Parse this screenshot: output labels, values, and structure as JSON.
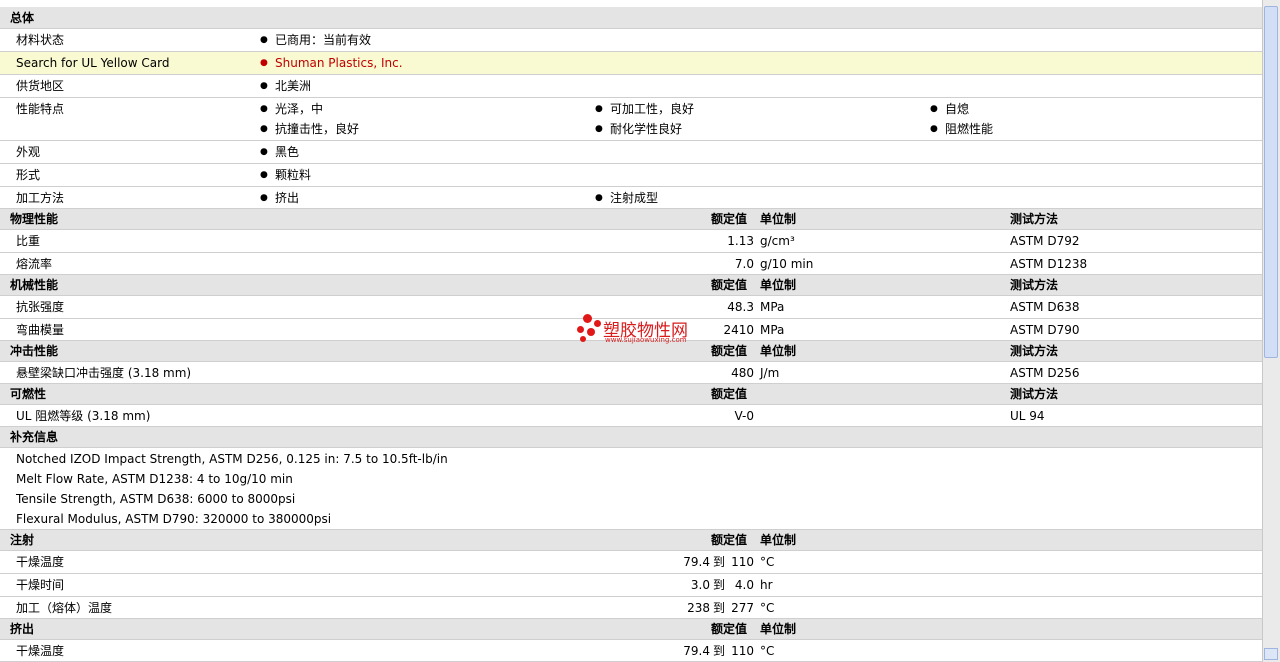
{
  "overall": {
    "title": "总体",
    "rows": [
      {
        "label": "材料状态",
        "items": [
          "已商用：当前有效"
        ]
      },
      {
        "label": "Search for UL Yellow Card",
        "items": [
          "Shuman Plastics, Inc."
        ]
      },
      {
        "label": "供货地区",
        "items": [
          "北美洲"
        ]
      },
      {
        "label": "性能特点",
        "items": [
          "光泽，中",
          "抗撞击性，良好",
          "可加工性，良好",
          "耐化学性良好",
          "自熄",
          "阻燃性能"
        ]
      },
      {
        "label": "外观",
        "items": [
          "黑色"
        ]
      },
      {
        "label": "形式",
        "items": [
          "颗粒料"
        ]
      },
      {
        "label": "加工方法",
        "items": [
          "挤出",
          "注射成型"
        ]
      }
    ]
  },
  "col_headers": {
    "nominal": "额定值",
    "unit": "单位制",
    "method": "测试方法"
  },
  "physical": {
    "title": "物理性能",
    "rows": [
      {
        "label": "比重",
        "value": "1.13",
        "unit": "g/cm³",
        "method": "ASTM D792"
      },
      {
        "label": "熔流率",
        "value": "7.0",
        "unit": "g/10 min",
        "method": "ASTM D1238"
      }
    ]
  },
  "mechanical": {
    "title": "机械性能",
    "rows": [
      {
        "label": "抗张强度",
        "value": "48.3",
        "unit": "MPa",
        "method": "ASTM D638"
      },
      {
        "label": "弯曲模量",
        "value": "2410",
        "unit": "MPa",
        "method": "ASTM D790"
      }
    ]
  },
  "impact": {
    "title": "冲击性能",
    "rows": [
      {
        "label": "悬壁梁缺口冲击强度  (3.18 mm)",
        "value": "480",
        "unit": "J/m",
        "method": "ASTM D256"
      }
    ]
  },
  "flammability": {
    "title": "可燃性",
    "rows": [
      {
        "label": "UL 阻燃等级  (3.18 mm)",
        "value": "V-0",
        "method": "UL 94"
      }
    ]
  },
  "supplemental": {
    "title": "补充信息",
    "lines": [
      "Notched IZOD Impact Strength, ASTM D256, 0.125 in: 7.5 to 10.5ft-lb/in",
      "Melt Flow Rate, ASTM D1238: 4 to 10g/10 min",
      "Tensile Strength, ASTM D638: 6000 to 8000psi",
      "Flexural Modulus, ASTM D790: 320000 to 380000psi"
    ]
  },
  "range_word": "到",
  "injection": {
    "title": "注射",
    "rows": [
      {
        "label": "干燥温度",
        "low": "79.4",
        "high": "110",
        "unit": "°C"
      },
      {
        "label": "干燥时间",
        "low": "3.0",
        "high": "4.0",
        "unit": "hr"
      },
      {
        "label": "加工（熔体）温度",
        "low": "238",
        "high": "277",
        "unit": "°C"
      }
    ]
  },
  "extrusion": {
    "title": "挤出",
    "rows": [
      {
        "label": "干燥温度",
        "low": "79.4",
        "high": "110",
        "unit": "°C"
      }
    ]
  },
  "watermark": {
    "name": "塑胶物性网",
    "url": "www.sujiaowuxing.com"
  },
  "colors": {
    "header_bg": "#e4e4e4",
    "highlight_bg": "#fafad2",
    "link": "#c00000",
    "watermark": "#d81c1c"
  }
}
